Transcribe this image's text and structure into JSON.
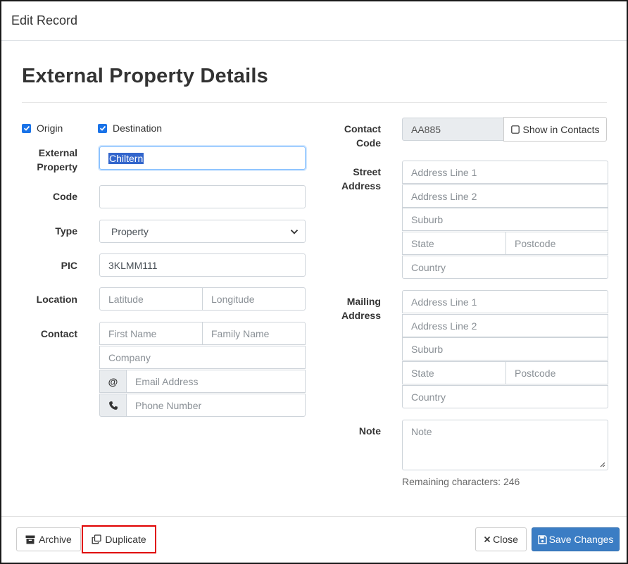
{
  "modal": {
    "title": "Edit Record"
  },
  "section": {
    "title": "External Property Details"
  },
  "left": {
    "origin_label": "Origin",
    "destination_label": "Destination",
    "external_property_label": "External Property",
    "external_property_value": "Chiltern",
    "code_label": "Code",
    "code_value": "",
    "type_label": "Type",
    "type_value": "Property",
    "pic_label": "PIC",
    "pic_value": "3KLMM111",
    "location_label": "Location",
    "latitude_placeholder": "Latitude",
    "longitude_placeholder": "Longitude",
    "contact_label": "Contact",
    "first_name_placeholder": "First Name",
    "family_name_placeholder": "Family Name",
    "company_placeholder": "Company",
    "email_addon": "@",
    "email_placeholder": "Email Address",
    "phone_placeholder": "Phone Number"
  },
  "right": {
    "contact_code_label": "Contact Code",
    "contact_code_value": "AA885",
    "show_in_contacts_label": "Show in Contacts",
    "street_address_label": "Street Address",
    "mailing_address_label": "Mailing Address",
    "address_line1_placeholder": "Address Line 1",
    "address_line2_placeholder": "Address Line 2",
    "suburb_placeholder": "Suburb",
    "state_placeholder": "State",
    "postcode_placeholder": "Postcode",
    "country_placeholder": "Country",
    "note_label": "Note",
    "note_placeholder": "Note",
    "remaining_text": "Remaining characters: 246"
  },
  "footer": {
    "archive_label": "Archive",
    "duplicate_label": "Duplicate",
    "close_label": "Close",
    "save_label": "Save Changes"
  },
  "colors": {
    "primary": "#3b7dc4",
    "checkbox": "#1a73e8",
    "highlight_outline": "#e00000"
  }
}
